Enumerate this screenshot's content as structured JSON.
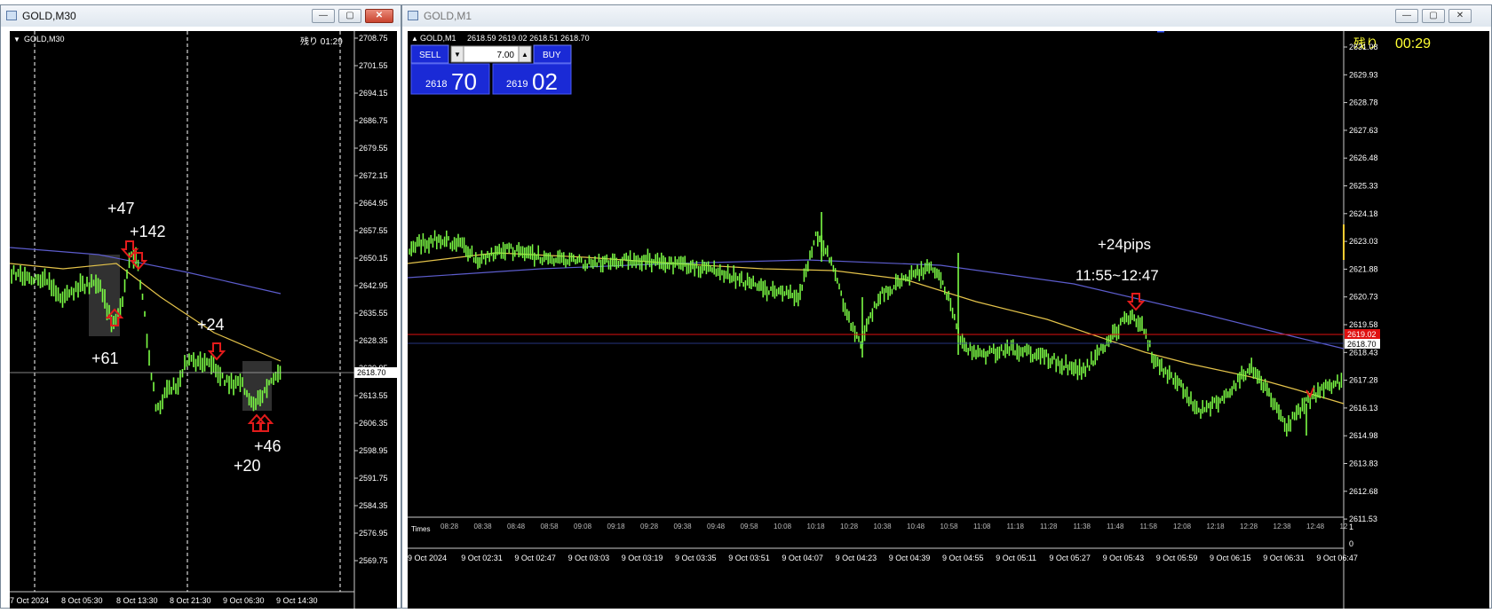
{
  "left_window": {
    "title": "GOLD,M30",
    "chart_label": "GOLD,M30",
    "timer": "残り 01:29",
    "price_ticks": [
      "2708.75",
      "2701.55",
      "2694.15",
      "2686.75",
      "2679.55",
      "2672.15",
      "2664.95",
      "2657.55",
      "2650.15",
      "2642.95",
      "2635.55",
      "2628.35",
      "2620.95",
      "2613.55",
      "2606.35",
      "2598.95",
      "2591.75",
      "2584.35",
      "2576.95",
      "2569.75"
    ],
    "current_price": "2618.70",
    "time_labels": [
      "7 Oct 2024",
      "8 Oct 05:30",
      "8 Oct 13:30",
      "8 Oct 21:30",
      "9 Oct 06:30",
      "9 Oct 14:30"
    ],
    "annotations": [
      "+47",
      "+142",
      "+61",
      "+24",
      "+46",
      "+20"
    ]
  },
  "right_window": {
    "title": "GOLD,M1",
    "chart_label": "GOLD,M1",
    "ohlc": "2618.59 2619.02 2618.51 2618.70",
    "timer_label": "残り",
    "timer_value": "00:29",
    "trade_panel": {
      "sell_label": "SELL",
      "buy_label": "BUY",
      "volume": "7.00",
      "sell_price_big": "2618",
      "sell_price_small": "70",
      "buy_price_big": "2619",
      "buy_price_small": "02"
    },
    "price_ticks": [
      "2631.08",
      "2629.93",
      "2628.78",
      "2627.63",
      "2626.48",
      "2625.33",
      "2624.18",
      "2623.03",
      "2621.88",
      "2620.73",
      "2619.58",
      "2618.43",
      "2617.28",
      "2616.13",
      "2614.98",
      "2613.83",
      "2612.68",
      "2611.53"
    ],
    "bid_price": "2618.70",
    "ask_price": "2619.02",
    "sub_ticks": [
      "1",
      "0"
    ],
    "indicator_label": "Times",
    "session_labels": [
      "08:28",
      "08:38",
      "08:48",
      "08:58",
      "09:08",
      "09:18",
      "09:28",
      "09:38",
      "09:48",
      "09:58",
      "10:08",
      "10:18",
      "10:28",
      "10:38",
      "10:48",
      "10:58",
      "11:08",
      "11:18",
      "11:28",
      "11:38",
      "11:48",
      "11:58",
      "12:08",
      "12:18",
      "12:28",
      "12:38",
      "12:48",
      "12"
    ],
    "time_labels": [
      "9 Oct 2024",
      "9 Oct 02:31",
      "9 Oct 02:47",
      "9 Oct 03:03",
      "9 Oct 03:19",
      "9 Oct 03:35",
      "9 Oct 03:51",
      "9 Oct 04:07",
      "9 Oct 04:23",
      "9 Oct 04:39",
      "9 Oct 04:55",
      "9 Oct 05:11",
      "9 Oct 05:27",
      "9 Oct 05:43",
      "9 Oct 05:59",
      "9 Oct 06:15",
      "9 Oct 06:31",
      "9 Oct 06:47"
    ],
    "annotation_pips": "+24pips",
    "annotation_time": "11:55~12:47"
  },
  "colors": {
    "candle": "#7cfc45",
    "ma_fast": "#e3c24a",
    "ma_slow": "#5c5ccc",
    "arrow": "#e21b1b",
    "trade_blue": "#1a2ad6",
    "bid_line": "#b0b0b0",
    "ask_line": "#e01010"
  }
}
